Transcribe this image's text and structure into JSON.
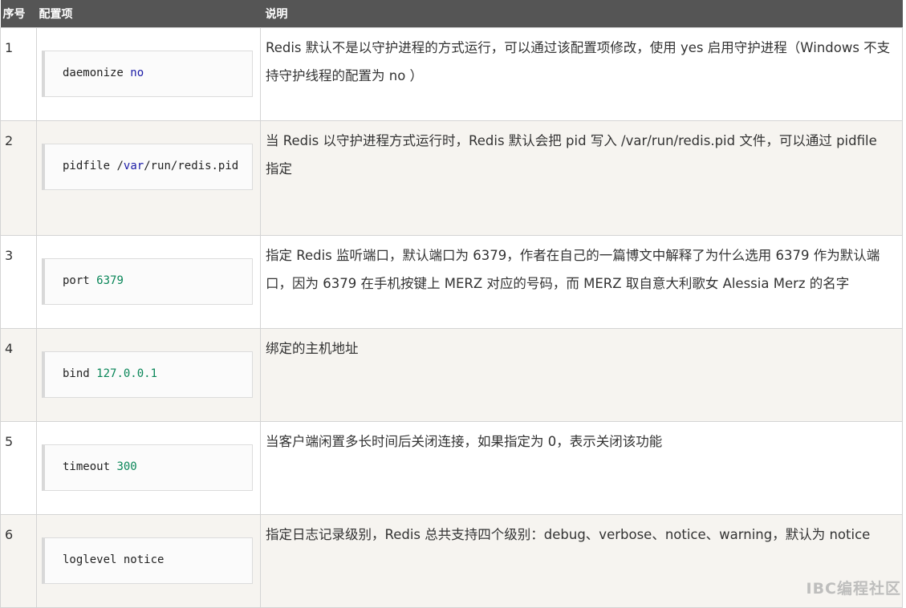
{
  "headers": {
    "num": "序号",
    "item": "配置项",
    "desc": "说明"
  },
  "rows": [
    {
      "num": "1",
      "code_key": "daemonize",
      "code_val": "no",
      "val_style": "kw",
      "desc": "Redis 默认不是以守护进程的方式运行，可以通过该配置项修改，使用 yes 启用守护进程（Windows 不支持守护线程的配置为 no ）"
    },
    {
      "num": "2",
      "code_key": "pidfile",
      "code_val": "/var/run/redis.pid",
      "val_style": "path",
      "desc": "当 Redis 以守护进程方式运行时，Redis 默认会把 pid 写入 /var/run/redis.pid 文件，可以通过 pidfile 指定"
    },
    {
      "num": "3",
      "code_key": "port",
      "code_val": "6379",
      "val_style": "nm",
      "desc": "指定 Redis 监听端口，默认端口为 6379，作者在自己的一篇博文中解释了为什么选用 6379 作为默认端口，因为 6379 在手机按键上 MERZ 对应的号码，而 MERZ 取自意大利歌女 Alessia Merz 的名字"
    },
    {
      "num": "4",
      "code_key": "bind",
      "code_val": "127.0.0.1",
      "val_style": "nm",
      "desc": "绑定的主机地址"
    },
    {
      "num": "5",
      "code_key": "timeout",
      "code_val": "300",
      "val_style": "nm",
      "desc": "当客户端闲置多长时间后关闭连接，如果指定为 0，表示关闭该功能"
    },
    {
      "num": "6",
      "code_key": "loglevel",
      "code_val": "notice",
      "val_style": "plain",
      "desc": "指定日志记录级别，Redis 总共支持四个级别：debug、verbose、notice、warning，默认为 notice"
    }
  ],
  "watermark": "IBC编程社区"
}
